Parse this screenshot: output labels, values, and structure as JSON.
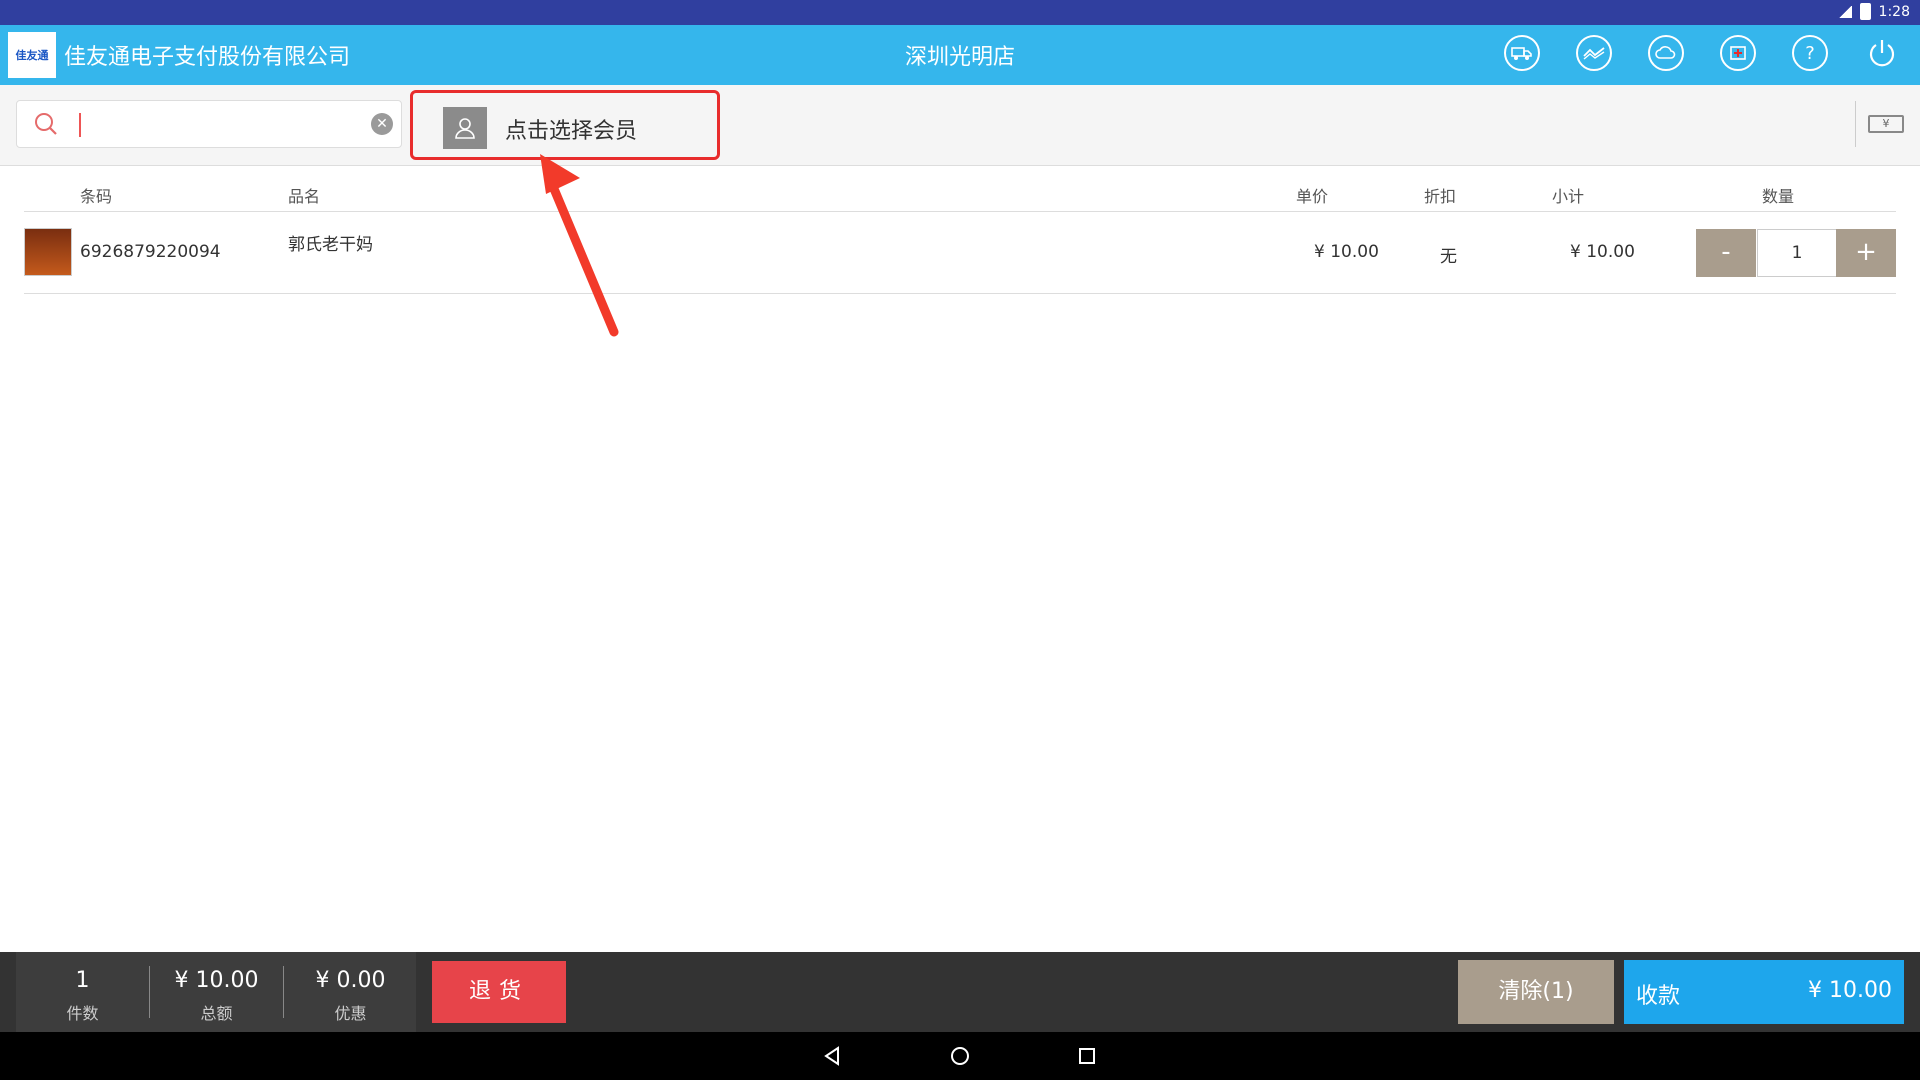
{
  "status_bar": {
    "time": "1:28"
  },
  "header": {
    "logo_text": "佳友通",
    "company": "佳友通电子支付股份有限公司",
    "store": "深圳光明店",
    "icons": [
      "delivery-icon",
      "trend-icon",
      "cloud-icon",
      "medical-icon",
      "help-icon",
      "power-icon"
    ]
  },
  "search": {
    "value": "",
    "placeholder": ""
  },
  "member": {
    "label": "点击选择会员"
  },
  "table": {
    "headers": {
      "barcode": "条码",
      "name": "品名",
      "price": "单价",
      "discount": "折扣",
      "subtotal": "小计",
      "qty": "数量"
    },
    "rows": [
      {
        "barcode": "6926879220094",
        "name": "郭氏老干妈",
        "price": "¥ 10.00",
        "discount": "无",
        "subtotal": "¥ 10.00",
        "qty": "1",
        "minus": "-",
        "plus": "+"
      }
    ]
  },
  "summary": {
    "count": "1",
    "count_label": "件数",
    "total": "¥ 10.00",
    "total_label": "总额",
    "discount": "¥ 0.00",
    "discount_label": "优惠"
  },
  "buttons": {
    "return": "退货",
    "clear": "清除(1)",
    "pay_label": "收款",
    "pay_amount": "¥ 10.00"
  },
  "colors": {
    "header": "#35b6ec",
    "status": "#303f9f",
    "highlight": "#e82c2c",
    "return": "#e7444a",
    "pay": "#1ea6ec"
  }
}
